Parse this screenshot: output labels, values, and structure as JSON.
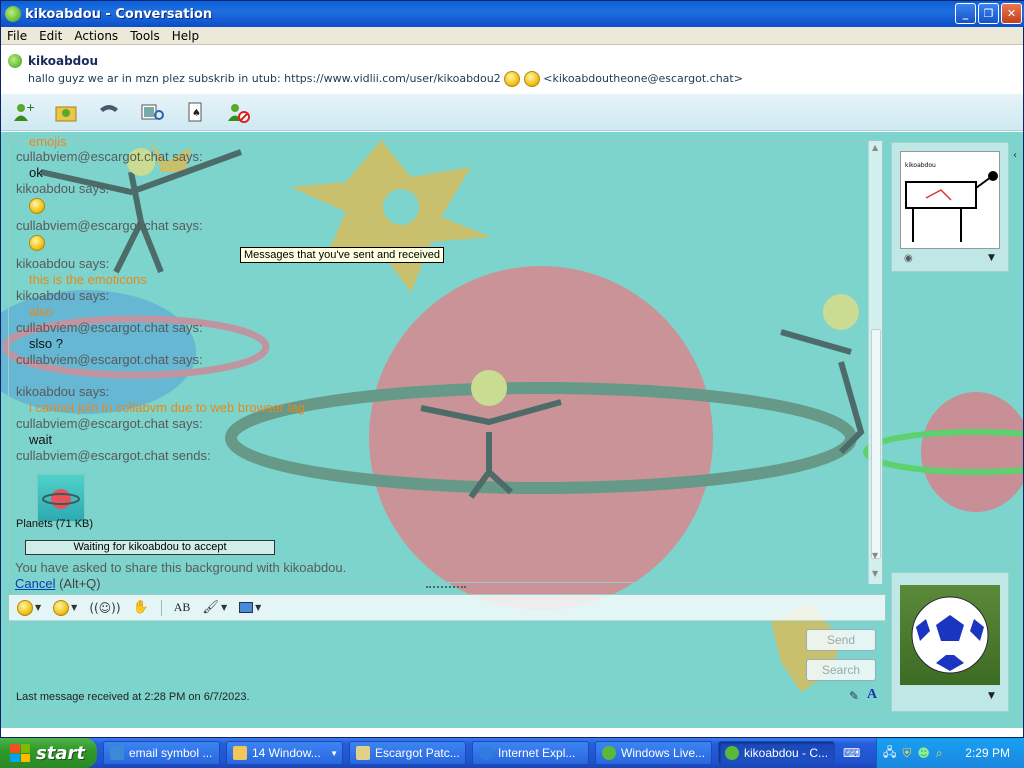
{
  "window": {
    "title": "kikoabdou - Conversation"
  },
  "menu": [
    "File",
    "Edit",
    "Actions",
    "Tools",
    "Help"
  ],
  "contact": {
    "name": "kikoabdou",
    "personal_message": "hallo guyz we ar in mzn plez subskrib in utub: https://www.vidlii.com/user/kikoabdou2",
    "email": "<kikoabdoutheone@escargot.chat>"
  },
  "chat": {
    "cut_top": "emojis",
    "entries": [
      {
        "who": "cullabviem@escargot.chat says:",
        "text": "ok",
        "style": "normal"
      },
      {
        "who": "kikoabdou says:",
        "text": "",
        "style": "emoticon-cool"
      },
      {
        "who": "cullabviem@escargot.chat says:",
        "text": "",
        "style": "emoticon-smile"
      },
      {
        "who": "kikoabdou says:",
        "text": "this is the emoticons",
        "style": "orange"
      },
      {
        "who": "kikoabdou says:",
        "text": "also",
        "style": "orange"
      },
      {
        "who": "cullabviem@escargot.chat says:",
        "text": "slso ?",
        "style": "normal"
      },
      {
        "who": "cullabviem@escargot.chat says:",
        "text": "",
        "style": "normal"
      },
      {
        "who": "kikoabdou says:",
        "text": "i cannot join in collabvm due to web browser lag",
        "style": "orange"
      },
      {
        "who": "cullabviem@escargot.chat says:",
        "text": "wait",
        "style": "normal"
      }
    ],
    "send_line": "cullabviem@escargot.chat sends:",
    "file_label": "Planets (71 KB)",
    "progress_text": "Waiting for kikoabdou to accept",
    "share_notice": "You have asked to share this background with kikoabdou.",
    "cancel_link": "Cancel",
    "cancel_shortcut": "(Alt+Q)",
    "tooltip": "Messages that you've sent and received"
  },
  "compose": {
    "send_label": "Send",
    "search_label": "Search",
    "last_message": "Last message received at 2:28 PM on 6/7/2023."
  },
  "display_picture_label": "kikoabdou",
  "taskbar": {
    "start": "start",
    "tasks": [
      {
        "label": "email symbol ...",
        "icon": "ie-icon",
        "active": false
      },
      {
        "label": "14 Window...",
        "icon": "folder-icon",
        "active": false
      },
      {
        "label": "Escargot Patc...",
        "icon": "patch-icon",
        "active": false
      },
      {
        "label": "Internet Expl...",
        "icon": "ie-icon",
        "active": false
      },
      {
        "label": "Windows Live...",
        "icon": "messenger-icon",
        "active": false
      },
      {
        "label": "kikoabdou - C...",
        "icon": "messenger-icon",
        "active": true
      }
    ],
    "clock": "2:29 PM"
  },
  "colors": {
    "title_bar": "#1f6fe0",
    "chat_bg": "#7dd4cd",
    "orange_text": "#e6881c",
    "taskbar": "#245ddb",
    "start": "#3a9a2a"
  }
}
